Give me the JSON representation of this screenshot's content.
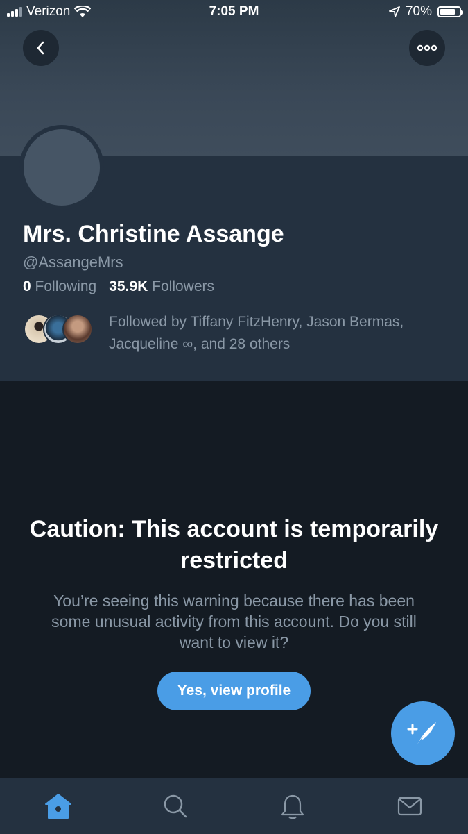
{
  "status_bar": {
    "carrier": "Verizon",
    "time": "7:05 PM",
    "battery": "70%"
  },
  "header": {
    "back_icon": "chevron-left-icon",
    "more_icon": "ellipsis-icon"
  },
  "profile": {
    "name": "Mrs. Christine Assange",
    "handle": "@AssangeMrs",
    "following_count": "0",
    "following_label": "Following",
    "followers_count": "35.9K",
    "followers_label": "Followers",
    "followed_by": "Followed by Tiffany FitzHenry, Jason Bermas, Jacqueline ∞, and 28 others"
  },
  "caution": {
    "title": "Caution: This account is temporarily restricted",
    "body": "You’re seeing this warning because there has been some unusual activity from this account. Do you still want to view it?",
    "button_label": "Yes, view profile"
  },
  "fab": {
    "icon": "compose-tweet-icon"
  },
  "tabbar": {
    "tabs": [
      "home-icon",
      "search-icon",
      "notifications-icon",
      "messages-icon"
    ],
    "active_color": "#4a9de6"
  }
}
